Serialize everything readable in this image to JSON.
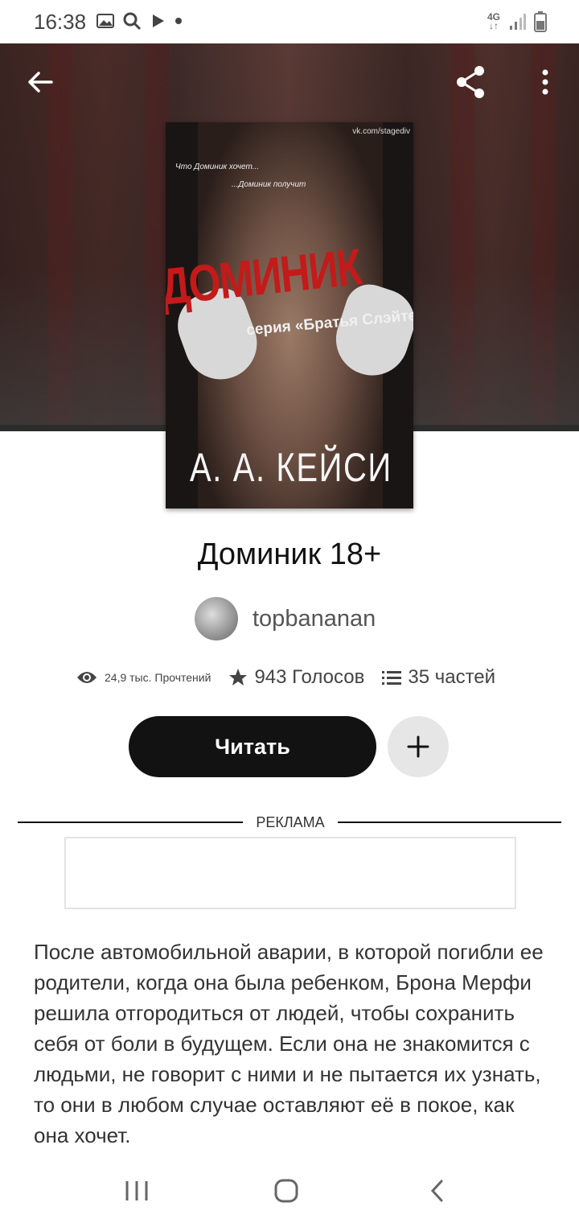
{
  "status_bar": {
    "time": "16:38",
    "network": "4G",
    "icons": [
      "image-icon",
      "search-icon",
      "play-icon",
      "dot-icon",
      "signal-icon",
      "battery-icon"
    ]
  },
  "header": {
    "back_icon": "arrow-left-icon",
    "share_icon": "share-icon",
    "more_icon": "more-vert-icon"
  },
  "cover": {
    "site": "vk.com/stagediv",
    "tagline_1": "Что Доминик хочет...",
    "tagline_2": "...Доминик получит",
    "title": "ДОМИНИК",
    "series": "серия «Братья Слэйтер»",
    "author": "А. А.  КЕЙСИ"
  },
  "story": {
    "title": "Доминик 18+",
    "author": "topbananan",
    "reads": "24,9 тыс. Прочтений",
    "votes": "943 Голосов",
    "parts": "35 частей",
    "read_label": "Читать",
    "add_icon": "plus-icon"
  },
  "ad": {
    "label": "РЕКЛАМА"
  },
  "description": "После автомобильной аварии, в которой погибли ее родители, когда она была ребенком, Брона Мерфи решила отгородиться от людей, чтобы сохранить себя от боли в будущем. Если она не знакомится с людьми, не говорит с ними и не пытается их узнать, то они в любом случае оставляют её в покое, как она хочет.",
  "nav": {
    "recent_icon": "recent-apps-icon",
    "home_icon": "home-icon",
    "back_icon": "back-chevron-icon"
  },
  "colors": {
    "primary_button": "#121212",
    "secondary_button": "#e6e6e6",
    "cover_title": "#c41a1a"
  }
}
